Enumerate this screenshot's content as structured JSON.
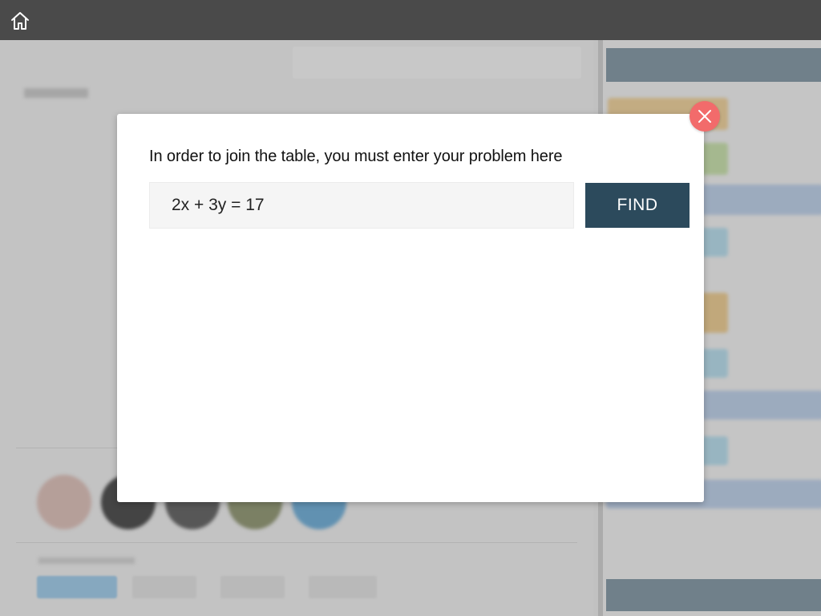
{
  "topbar": {
    "home_icon": "home-icon",
    "color": "#4a4a4a"
  },
  "modal": {
    "prompt": "In order to join the table, you must enter your problem here",
    "input_value": "2x + 3y = 17",
    "find_label": "FIND",
    "close_icon": "close-icon",
    "accent": "#2c4a5c",
    "close_color": "#f26b6b"
  }
}
